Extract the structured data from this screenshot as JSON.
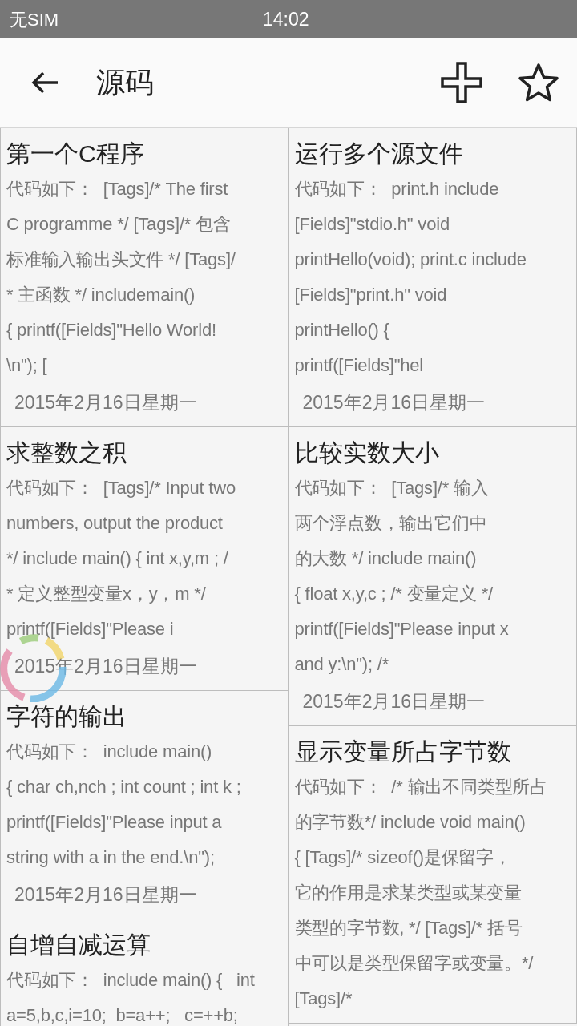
{
  "status_bar": {
    "carrier": "无SIM",
    "time": "14:02"
  },
  "header": {
    "title": "源码"
  },
  "columns": [
    [
      {
        "title": "第一个C程序",
        "lines": [
          "代码如下：  [Tags]/* The first",
          "C programme */ [Tags]/* 包含",
          "标准输入输出头文件 */ [Tags]/",
          "* 主函数 */ includemain()",
          "{ printf([Fields]\"Hello World!",
          "\\n\"); ["
        ],
        "date": "2015年2月16日星期一"
      },
      {
        "title": "求整数之积",
        "lines": [
          "代码如下：  [Tags]/* Input two",
          "numbers, output the product",
          "*/ include main() { int x,y,m ; /",
          "* 定义整型变量x，y，m */",
          "printf([Fields]\"Please i"
        ],
        "date": "2015年2月16日星期一"
      },
      {
        "title": "字符的输出",
        "lines": [
          "代码如下：  include main()",
          "{ char ch,nch ; int count ; int k ;",
          "printf([Fields]\"Please input a",
          "string with a in the end.\\n\");"
        ],
        "date": "2015年2月16日星期一"
      },
      {
        "title": "自增自减运算",
        "lines": [
          "代码如下：  include main() {   int",
          "a=5,b,c,i=10;  b=a++;   c=++b;"
        ]
      }
    ],
    [
      {
        "title": "运行多个源文件",
        "lines": [
          "代码如下：  print.h include",
          "[Fields]\"stdio.h\" void",
          "printHello(void); print.c include",
          "[Fields]\"print.h\" void",
          "printHello() {",
          "printf([Fields]\"hel"
        ],
        "date": "2015年2月16日星期一"
      },
      {
        "title": "比较实数大小",
        "lines": [
          "代码如下：  [Tags]/* 输入",
          "两个浮点数，输出它们中",
          "的大数 */ include main()",
          "{ float x,y,c ; /* 变量定义 */",
          "printf([Fields]\"Please input x",
          "and y:\\n\"); /*"
        ],
        "date": "2015年2月16日星期一"
      },
      {
        "title": "显示变量所占字节数",
        "lines": [
          "代码如下：  /* 输出不同类型所占",
          "的字节数*/ include void main()",
          "{ [Tags]/* sizeof()是保留字，",
          "它的作用是求某类型或某变量",
          "类型的字节数, */ [Tags]/* 括号",
          "中可以是类型保留字或变量。*/",
          "[Tags]/*"
        ]
      }
    ]
  ]
}
